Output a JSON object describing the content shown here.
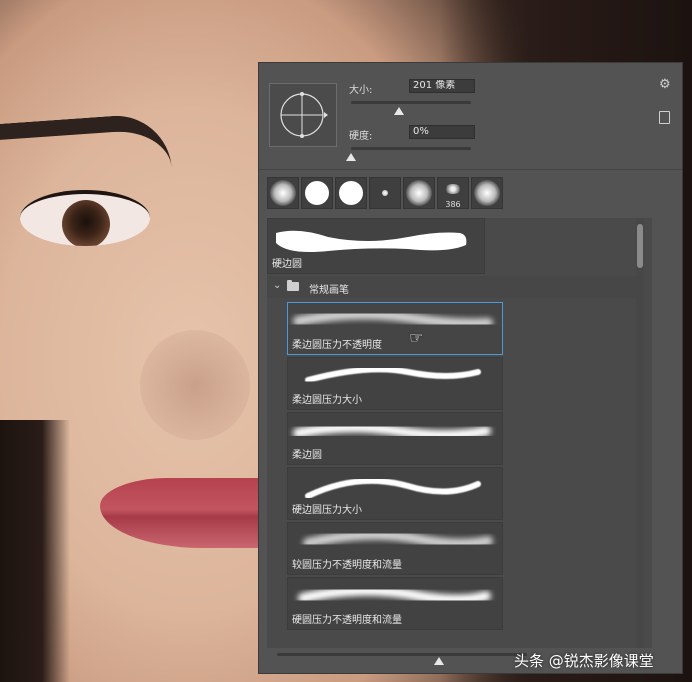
{
  "panel": {
    "size_label": "大小:",
    "size_value": "201 像素",
    "hardness_label": "硬度:",
    "hardness_value": "0%",
    "size_slider_value": 0.4,
    "hardness_slider_value": 0.0
  },
  "presets": [
    {
      "icon": "soft-round-brush",
      "number": ""
    },
    {
      "icon": "hard-round-brush",
      "number": ""
    },
    {
      "icon": "hard-round-brush",
      "number": ""
    },
    {
      "icon": "small-brush",
      "number": ""
    },
    {
      "icon": "soft-round-brush",
      "number": ""
    },
    {
      "icon": "spatter-brush",
      "number": "386"
    },
    {
      "icon": "soft-round-brush",
      "number": ""
    }
  ],
  "recent_brush": {
    "name": "硬边圆"
  },
  "group": {
    "name": "常规画笔"
  },
  "brushes": [
    {
      "name": "柔边圆压力不透明度",
      "selected": true
    },
    {
      "name": "柔边圆压力大小",
      "selected": false
    },
    {
      "name": "柔边圆",
      "selected": false
    },
    {
      "name": "硬边圆压力大小",
      "selected": false
    },
    {
      "name": "较圆压力不透明度和流量",
      "selected": false
    },
    {
      "name": "硬圆压力不透明度和流量",
      "selected": false
    }
  ],
  "watermark": "头条 @锐杰影像课堂",
  "colors": {
    "panel_bg": "#535353",
    "selection": "#4a9ad8"
  }
}
